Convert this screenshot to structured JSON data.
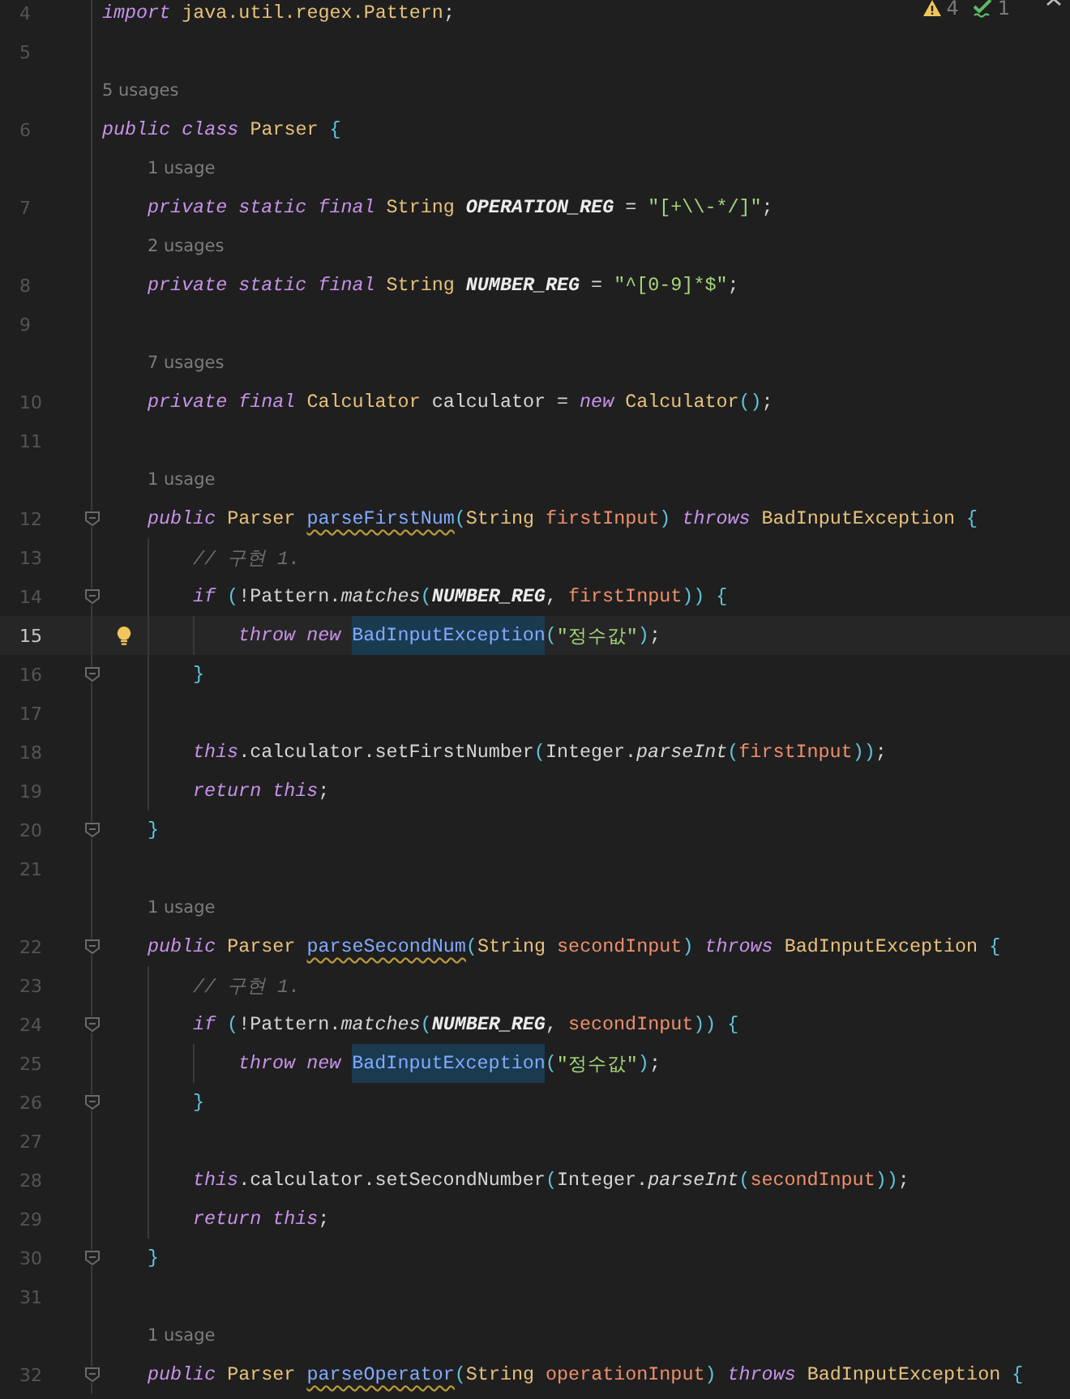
{
  "inspections": [
    {
      "kind": "warning",
      "count": "4"
    },
    {
      "kind": "weak-warning",
      "count": "1"
    }
  ],
  "lines": [
    {
      "number": "4",
      "tokens": [
        {
          "kind": "kw",
          "t": "import "
        },
        {
          "kind": "cls",
          "t": "java.util.regex.Pattern"
        },
        {
          "kind": "p",
          "t": ";"
        }
      ]
    },
    {
      "number": "5"
    },
    {
      "usages": "5 usages"
    },
    {
      "number": "6",
      "tokens": [
        {
          "kind": "kw",
          "t": "public class "
        },
        {
          "kind": "cls",
          "t": "Parser "
        },
        {
          "kind": "br",
          "t": "{"
        }
      ],
      "children": [
        {
          "usages": "1 usage"
        },
        {
          "number": "7",
          "tokens": [
            {
              "kind": "kw",
              "t": "private static final "
            },
            {
              "kind": "cls",
              "t": "String "
            },
            {
              "kind": "const",
              "t": "OPERATION_REG"
            },
            {
              "kind": "p",
              "t": " = "
            },
            {
              "kind": "str",
              "t": "\"[+\\\\-*/]\""
            },
            {
              "kind": "p",
              "t": ";"
            }
          ]
        },
        {
          "usages": "2 usages"
        },
        {
          "number": "8",
          "tokens": [
            {
              "kind": "kw",
              "t": "private static final "
            },
            {
              "kind": "cls",
              "t": "String "
            },
            {
              "kind": "const",
              "t": "NUMBER_REG"
            },
            {
              "kind": "p",
              "t": " = "
            },
            {
              "kind": "str",
              "t": "\"^[0-9]*$\""
            },
            {
              "kind": "p",
              "t": ";"
            }
          ]
        },
        {
          "number": "9"
        },
        {
          "usages": "7 usages"
        },
        {
          "number": "10",
          "tokens": [
            {
              "kind": "kw",
              "t": "private final "
            },
            {
              "kind": "cls",
              "t": "Calculator "
            },
            {
              "kind": "p",
              "t": "calculator = "
            },
            {
              "kind": "kw",
              "t": "new "
            },
            {
              "kind": "cls",
              "t": "Calculator"
            },
            {
              "kind": "br",
              "t": "()"
            },
            {
              "kind": "p",
              "t": ";"
            }
          ]
        },
        {
          "number": "11"
        },
        {
          "usages": "1 usage"
        },
        {
          "number": "12",
          "fold": true,
          "tokens": [
            {
              "kind": "kw",
              "t": "public "
            },
            {
              "kind": "cls",
              "t": "Parser "
            },
            {
              "kind": "fn",
              "t": "parseFirstNum"
            },
            {
              "kind": "br",
              "t": "("
            },
            {
              "kind": "cls",
              "t": "String "
            },
            {
              "kind": "param",
              "t": "firstInput"
            },
            {
              "kind": "br",
              "t": ")"
            },
            {
              "kind": "kw",
              "t": " throws "
            },
            {
              "kind": "cls",
              "t": "BadInputException "
            },
            {
              "kind": "br",
              "t": "{"
            }
          ],
          "children": [
            {
              "number": "13",
              "tokens": [
                {
                  "kind": "cmt",
                  "t": "// 구현 1."
                }
              ]
            },
            {
              "number": "14",
              "fold": true,
              "tokens": [
                {
                  "kind": "kw",
                  "t": "if "
                },
                {
                  "kind": "br",
                  "t": "("
                },
                {
                  "kind": "p",
                  "t": "!Pattern."
                },
                {
                  "kind": "call",
                  "t": "matches"
                },
                {
                  "kind": "br",
                  "t": "("
                },
                {
                  "kind": "const",
                  "t": "NUMBER_REG"
                },
                {
                  "kind": "p",
                  "t": ", "
                },
                {
                  "kind": "param",
                  "t": "firstInput"
                },
                {
                  "kind": "br",
                  "t": ")) {"
                }
              ],
              "children": [
                {
                  "number": "15",
                  "current": true,
                  "intention": true,
                  "tokens": [
                    {
                      "kind": "kw",
                      "t": "throw new "
                    },
                    {
                      "kind": "hl",
                      "t": "BadInputException"
                    },
                    {
                      "kind": "br",
                      "t": "("
                    },
                    {
                      "kind": "str",
                      "t": "\"정수값\""
                    },
                    {
                      "kind": "br",
                      "t": ")"
                    },
                    {
                      "kind": "p",
                      "t": ";"
                    }
                  ]
                }
              ]
            },
            {
              "number": "16",
              "fold": true,
              "tokens": [
                {
                  "kind": "br",
                  "t": "}"
                }
              ]
            },
            {
              "number": "17"
            },
            {
              "number": "18",
              "tokens": [
                {
                  "kind": "kw",
                  "t": "this"
                },
                {
                  "kind": "p",
                  "t": ".calculator.setFirstNumber"
                },
                {
                  "kind": "br",
                  "t": "("
                },
                {
                  "kind": "p",
                  "t": "Integer."
                },
                {
                  "kind": "call",
                  "t": "parseInt"
                },
                {
                  "kind": "br",
                  "t": "("
                },
                {
                  "kind": "param",
                  "t": "firstInput"
                },
                {
                  "kind": "br",
                  "t": "))"
                },
                {
                  "kind": "p",
                  "t": ";"
                }
              ]
            },
            {
              "number": "19",
              "tokens": [
                {
                  "kind": "kw",
                  "t": "return this"
                },
                {
                  "kind": "p",
                  "t": ";"
                }
              ]
            }
          ]
        },
        {
          "number": "20",
          "fold": true,
          "tokens": [
            {
              "kind": "br",
              "t": "}"
            }
          ]
        },
        {
          "number": "21"
        },
        {
          "usages": "1 usage"
        },
        {
          "number": "22",
          "fold": true,
          "tokens": [
            {
              "kind": "kw",
              "t": "public "
            },
            {
              "kind": "cls",
              "t": "Parser "
            },
            {
              "kind": "fn",
              "t": "parseSecondNum"
            },
            {
              "kind": "br",
              "t": "("
            },
            {
              "kind": "cls",
              "t": "String "
            },
            {
              "kind": "param",
              "t": "secondInput"
            },
            {
              "kind": "br",
              "t": ")"
            },
            {
              "kind": "kw",
              "t": " throws "
            },
            {
              "kind": "cls",
              "t": "BadInputException "
            },
            {
              "kind": "br",
              "t": "{"
            }
          ],
          "children": [
            {
              "number": "23",
              "tokens": [
                {
                  "kind": "cmt",
                  "t": "// 구현 1."
                }
              ]
            },
            {
              "number": "24",
              "fold": true,
              "tokens": [
                {
                  "kind": "kw",
                  "t": "if "
                },
                {
                  "kind": "br",
                  "t": "("
                },
                {
                  "kind": "p",
                  "t": "!Pattern."
                },
                {
                  "kind": "call",
                  "t": "matches"
                },
                {
                  "kind": "br",
                  "t": "("
                },
                {
                  "kind": "const",
                  "t": "NUMBER_REG"
                },
                {
                  "kind": "p",
                  "t": ", "
                },
                {
                  "kind": "param",
                  "t": "secondInput"
                },
                {
                  "kind": "br",
                  "t": ")) {"
                }
              ],
              "children": [
                {
                  "number": "25",
                  "tokens": [
                    {
                      "kind": "kw",
                      "t": "throw new "
                    },
                    {
                      "kind": "hl",
                      "t": "BadInputException"
                    },
                    {
                      "kind": "br",
                      "t": "("
                    },
                    {
                      "kind": "str",
                      "t": "\"정수값\""
                    },
                    {
                      "kind": "br",
                      "t": ")"
                    },
                    {
                      "kind": "p",
                      "t": ";"
                    }
                  ]
                }
              ]
            },
            {
              "number": "26",
              "fold": true,
              "tokens": [
                {
                  "kind": "br",
                  "t": "}"
                }
              ]
            },
            {
              "number": "27"
            },
            {
              "number": "28",
              "tokens": [
                {
                  "kind": "kw",
                  "t": "this"
                },
                {
                  "kind": "p",
                  "t": ".calculator.setSecondNumber"
                },
                {
                  "kind": "br",
                  "t": "("
                },
                {
                  "kind": "p",
                  "t": "Integer."
                },
                {
                  "kind": "call",
                  "t": "parseInt"
                },
                {
                  "kind": "br",
                  "t": "("
                },
                {
                  "kind": "param",
                  "t": "secondInput"
                },
                {
                  "kind": "br",
                  "t": "))"
                },
                {
                  "kind": "p",
                  "t": ";"
                }
              ]
            },
            {
              "number": "29",
              "tokens": [
                {
                  "kind": "kw",
                  "t": "return this"
                },
                {
                  "kind": "p",
                  "t": ";"
                }
              ]
            }
          ]
        },
        {
          "number": "30",
          "fold": true,
          "tokens": [
            {
              "kind": "br",
              "t": "}"
            }
          ]
        },
        {
          "number": "31"
        },
        {
          "usages": "1 usage"
        },
        {
          "number": "32",
          "fold": true,
          "tokens": [
            {
              "kind": "kw",
              "t": "public "
            },
            {
              "kind": "cls",
              "t": "Parser "
            },
            {
              "kind": "fn",
              "t": "parseOperator"
            },
            {
              "kind": "br",
              "t": "("
            },
            {
              "kind": "cls",
              "t": "String "
            },
            {
              "kind": "param",
              "t": "operationInput"
            },
            {
              "kind": "br",
              "t": ")"
            },
            {
              "kind": "kw",
              "t": " throws "
            },
            {
              "kind": "cls",
              "t": "BadInputException "
            },
            {
              "kind": "br",
              "t": "{"
            }
          ]
        }
      ]
    }
  ]
}
